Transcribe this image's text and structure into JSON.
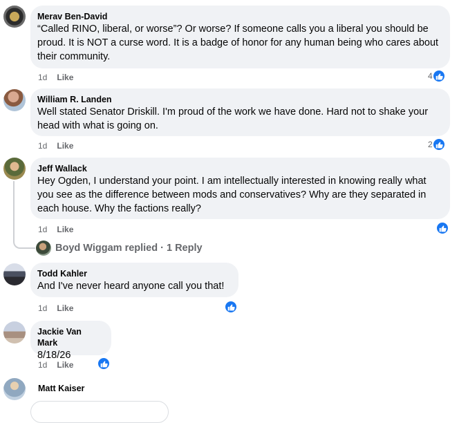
{
  "comments": [
    {
      "author": "Merav Ben-David",
      "text": "“Called RINO, liberal, or worse”? Or worse? If someone calls you a liberal you should be proud. It is NOT a curse word. It is a badge of honor for any human being who cares about their community.",
      "time": "1d",
      "like_label": "Like",
      "reaction_count": "4"
    },
    {
      "author": "William R. Landen",
      "text": "Well stated Senator Driskill. I'm proud of the work we have done. Hard not to shake your head with what is going on.",
      "time": "1d",
      "like_label": "Like",
      "reaction_count": "2"
    },
    {
      "author": "Jeff Wallack",
      "text": "Hey Ogden, I understand your point. I am intellectually interested in knowing really what you see as the difference between mods and conservatives? Why are they separated in each house. Why the factions really?",
      "time": "1d",
      "like_label": "Like",
      "reaction_count": ""
    },
    {
      "author": "Todd Kahler",
      "text": "And I've never heard anyone call you that!",
      "time": "1d",
      "like_label": "Like",
      "reaction_count": ""
    },
    {
      "author": "Jackie Van Mark",
      "text": "8/18/26",
      "time": "1d",
      "like_label": "Like",
      "reaction_count": ""
    },
    {
      "author": "Matt Kaiser",
      "text": ""
    }
  ],
  "replies": {
    "label": "Boyd Wiggam replied · 1 Reply"
  },
  "colors": {
    "bubble": "#f0f2f5",
    "like_blue": "#1877f2",
    "meta_gray": "#65676b"
  },
  "icons": {
    "reaction": "thumbs-up-icon"
  }
}
